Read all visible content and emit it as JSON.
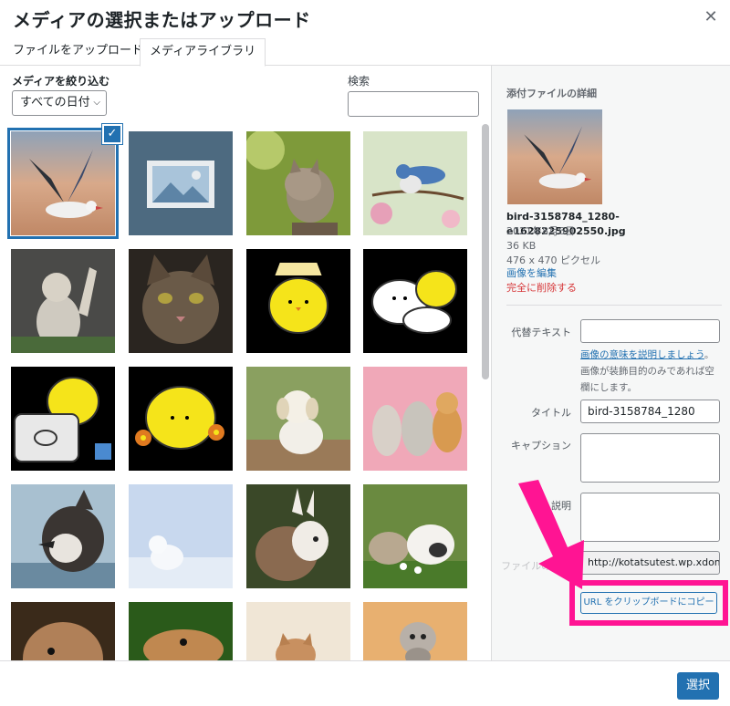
{
  "dialog": {
    "title": "メディアの選択またはアップロード",
    "close_icon": "close-icon"
  },
  "tabs": [
    {
      "label": "ファイルをアップロード",
      "active": false
    },
    {
      "label": "メディアライブラリ",
      "active": true
    }
  ],
  "filters": {
    "label": "メディアを絞り込む",
    "date_value": "すべての日付",
    "search_label": "検索",
    "search_value": ""
  },
  "attachments": [
    {
      "desc": "bird",
      "selected": true
    },
    {
      "desc": "placeholder-image"
    },
    {
      "desc": "kitten"
    },
    {
      "desc": "blue-bird"
    },
    {
      "desc": "cat-reaching"
    },
    {
      "desc": "tabby-cat"
    },
    {
      "desc": "chick-lamp"
    },
    {
      "desc": "chick-and-dog"
    },
    {
      "desc": "chick-laptop"
    },
    {
      "desc": "chick-flowers"
    },
    {
      "desc": "puppy"
    },
    {
      "desc": "dogs"
    },
    {
      "desc": "husky"
    },
    {
      "desc": "arctic-fox"
    },
    {
      "desc": "bunny"
    },
    {
      "desc": "bunnies"
    },
    {
      "desc": "rabbit"
    },
    {
      "desc": "rabbit-grass"
    },
    {
      "desc": "kittens"
    },
    {
      "desc": "scottish-fold"
    }
  ],
  "details": {
    "heading": "添付ファイルの詳細",
    "filename": "bird-3158784_1280-e1628225902550.jpg",
    "date": "2021年8月6日",
    "size": "36 KB",
    "dimensions": "476 x 470 ピクセル",
    "edit_link": "画像を編集",
    "delete_link": "完全に削除する",
    "alt_label": "代替テキスト",
    "alt_value": "",
    "alt_help_link": "画像の意味を説明しましょう",
    "alt_help_1": "。",
    "alt_help_2": "画像が装飾目的のみであれば空",
    "alt_help_3": "欄にします。",
    "title_label": "タイトル",
    "title_value": "bird-3158784_1280",
    "caption_label": "キャプション",
    "caption_value": "",
    "desc_label": "説明",
    "desc_value": "",
    "url_label": "ファイルのURL",
    "url_value": "http://kotatsutest.wp.xdomain.jp/",
    "copy_button": "URL をクリップボードにコピー"
  },
  "footer": {
    "select_button": "選択"
  },
  "colors": {
    "accent": "#2271b1",
    "highlight": "#ff1493",
    "delete": "#d63638"
  }
}
